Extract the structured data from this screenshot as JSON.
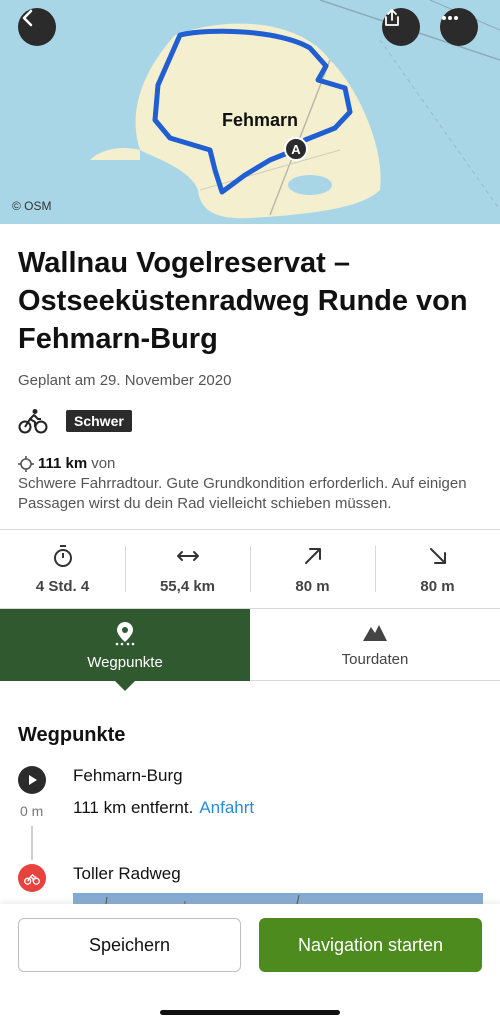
{
  "map": {
    "attribution": "© OSM",
    "place_label": "Fehmarn",
    "start_marker": "A",
    "icons": {
      "back": "chevron-left-icon",
      "share": "share-icon",
      "more": "more-dots-icon"
    }
  },
  "tour": {
    "title": "Wallnau Vogelreservat – Ostseeküstenradweg Runde von Fehmarn-Burg",
    "planned": "Geplant am 29. November 2020",
    "difficulty": "Schwer",
    "distance_bold": "111 km",
    "distance_suffix": "von",
    "description": "Schwere Fahrradtour. Gute Grundkondition erforderlich. Auf einigen Passagen wirst du dein Rad vielleicht schieben müssen."
  },
  "stats": [
    {
      "icon": "stopwatch-icon",
      "value": "4 Std. 4"
    },
    {
      "icon": "distance-arrows-icon",
      "value": "55,4 km"
    },
    {
      "icon": "arrow-up-right-icon",
      "value": "80 m"
    },
    {
      "icon": "arrow-down-right-icon",
      "value": "80 m"
    }
  ],
  "tabs": [
    {
      "label": "Wegpunkte",
      "icon": "waypoint-pin-icon",
      "active": true
    },
    {
      "label": "Tourdaten",
      "icon": "mountain-icon",
      "active": false
    }
  ],
  "waypoints": {
    "heading": "Wegpunkte",
    "items": [
      {
        "name": "Fehmarn-Burg",
        "dist_label": "0 m",
        "detail": "111 km entfernt.",
        "link": "Anfahrt"
      },
      {
        "name": "Toller Radweg"
      }
    ]
  },
  "actions": {
    "save": "Speichern",
    "navigate": "Navigation starten"
  },
  "colors": {
    "active_tab": "#30592f",
    "primary_button": "#4e8b1f",
    "link": "#2a8bd8",
    "route": "#1f5fd1",
    "waypoint_bike": "#e8423f"
  }
}
